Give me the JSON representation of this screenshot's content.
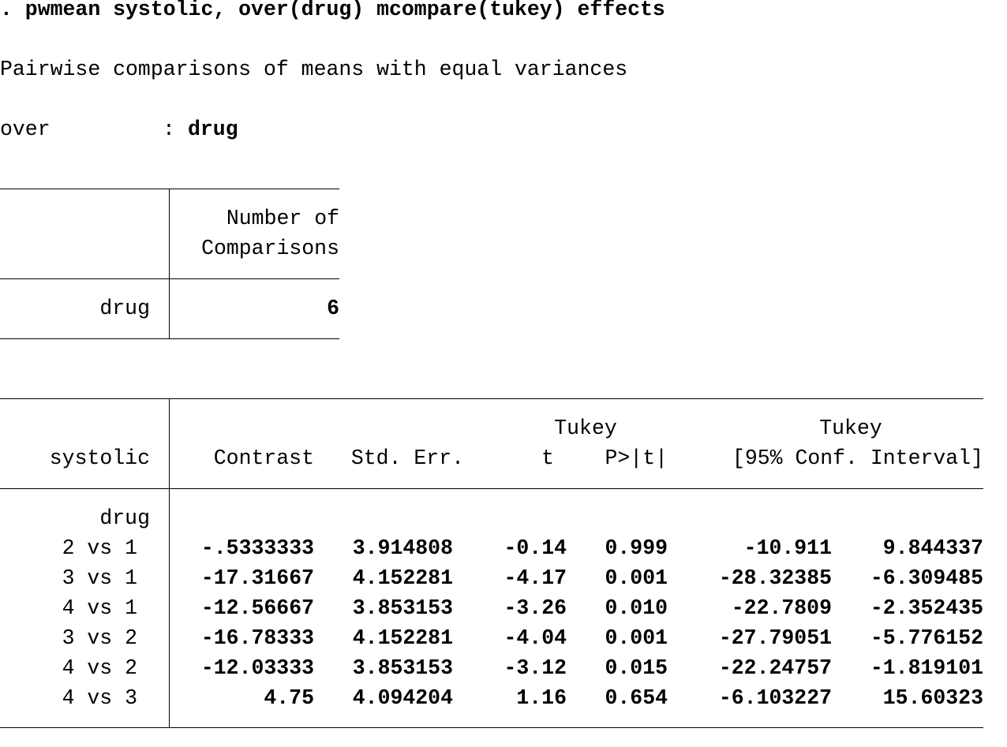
{
  "command": ". pwmean systolic, over(drug) mcompare(tukey) effects",
  "title": "Pairwise comparisons of means with equal variances",
  "over": {
    "label": "over",
    "separator": ":",
    "value": "drug"
  },
  "comparisons_table": {
    "header_line1": "Number of",
    "header_line2": "Comparisons",
    "row_label": "drug",
    "row_value": "6"
  },
  "results_table": {
    "depvar": "systolic",
    "headers": {
      "contrast": "Contrast",
      "std_err": "Std. Err.",
      "tukey_label_1": "Tukey",
      "t": "t",
      "p": "P>|t|",
      "tukey_label_2": "Tukey",
      "ci": "[95% Conf. Interval]"
    },
    "group_label": "drug",
    "rows": [
      {
        "label": "2 vs 1",
        "contrast": "-.5333333",
        "std_err": "3.914808",
        "t": "-0.14",
        "p": "0.999",
        "ci_low": "-10.911",
        "ci_high": "9.844337"
      },
      {
        "label": "3 vs 1",
        "contrast": "-17.31667",
        "std_err": "4.152281",
        "t": "-4.17",
        "p": "0.001",
        "ci_low": "-28.32385",
        "ci_high": "-6.309485"
      },
      {
        "label": "4 vs 1",
        "contrast": "-12.56667",
        "std_err": "3.853153",
        "t": "-3.26",
        "p": "0.010",
        "ci_low": "-22.7809",
        "ci_high": "-2.352435"
      },
      {
        "label": "3 vs 2",
        "contrast": "-16.78333",
        "std_err": "4.152281",
        "t": "-4.04",
        "p": "0.001",
        "ci_low": "-27.79051",
        "ci_high": "-5.776152"
      },
      {
        "label": "4 vs 2",
        "contrast": "-12.03333",
        "std_err": "3.853153",
        "t": "-3.12",
        "p": "0.015",
        "ci_low": "-22.24757",
        "ci_high": "-1.819101"
      },
      {
        "label": "4 vs 3",
        "contrast": "4.75",
        "std_err": "4.094204",
        "t": "1.16",
        "p": "0.654",
        "ci_low": "-6.103227",
        "ci_high": "15.60323"
      }
    ]
  }
}
